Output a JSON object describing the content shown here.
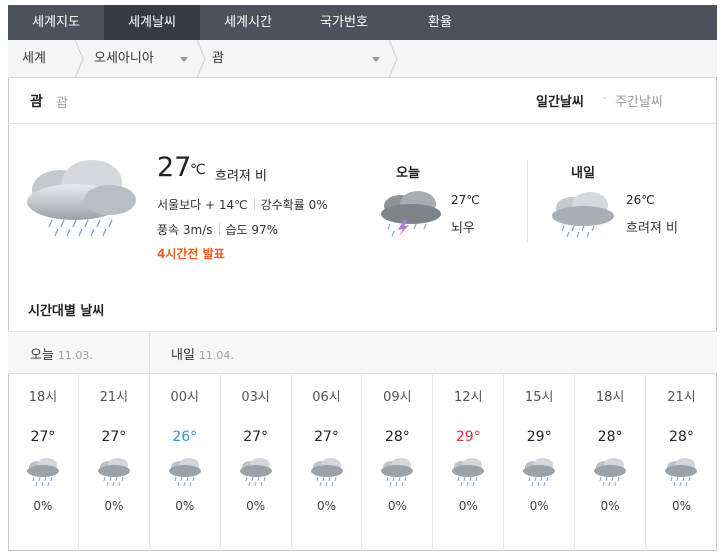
{
  "tabs": [
    {
      "label": "세계지도",
      "active": false
    },
    {
      "label": "세계날씨",
      "active": true
    },
    {
      "label": "세계시간",
      "active": false
    },
    {
      "label": "국가번호",
      "active": false
    },
    {
      "label": "환율",
      "active": false
    }
  ],
  "breadcrumb": {
    "world": "세계",
    "region": "오세아니아",
    "city": "괌"
  },
  "location": {
    "title": "괌",
    "subtitle": "괌",
    "daily_label": "일간날씨",
    "separator": "·",
    "weekly_label": "주간날씨"
  },
  "current": {
    "temp": "27",
    "unit": "℃",
    "condition": "흐려져 비",
    "compare_label": "서울보다 + 14℃",
    "rain_label": "강수확률 0%",
    "wind_label": "풍속 3m/s",
    "humidity_label": "습도 97%",
    "announce": "4시간전 발표",
    "icon": "cloud-rain-icon"
  },
  "today": {
    "title": "오늘",
    "temp": "27℃",
    "condition": "뇌우",
    "icon": "thunderstorm-icon"
  },
  "tomorrow": {
    "title": "내일",
    "temp": "26℃",
    "condition": "흐려져 비",
    "icon": "cloud-rain-icon"
  },
  "hourly": {
    "title": "시간대별 날씨",
    "today_label": "오늘",
    "today_date": "11.03.",
    "tomorrow_label": "내일",
    "tomorrow_date": "11.04.",
    "items": [
      {
        "time": "18시",
        "temp": "27°",
        "pct": "0%",
        "tone": "normal"
      },
      {
        "time": "21시",
        "temp": "27°",
        "pct": "0%",
        "tone": "normal"
      },
      {
        "time": "00시",
        "temp": "26°",
        "pct": "0%",
        "tone": "cold"
      },
      {
        "time": "03시",
        "temp": "27°",
        "pct": "0%",
        "tone": "normal"
      },
      {
        "time": "06시",
        "temp": "27°",
        "pct": "0%",
        "tone": "normal"
      },
      {
        "time": "09시",
        "temp": "28°",
        "pct": "0%",
        "tone": "normal"
      },
      {
        "time": "12시",
        "temp": "29°",
        "pct": "0%",
        "tone": "hot"
      },
      {
        "time": "15시",
        "temp": "29°",
        "pct": "0%",
        "tone": "normal"
      },
      {
        "time": "18시",
        "temp": "28°",
        "pct": "0%",
        "tone": "normal"
      },
      {
        "time": "21시",
        "temp": "28°",
        "pct": "0%",
        "tone": "normal"
      }
    ]
  },
  "colors": {
    "tab_bg": "#4c525c",
    "tab_active": "#363b43",
    "announce": "#f25b19",
    "cold": "#2a9bd8",
    "hot": "#e63232"
  }
}
